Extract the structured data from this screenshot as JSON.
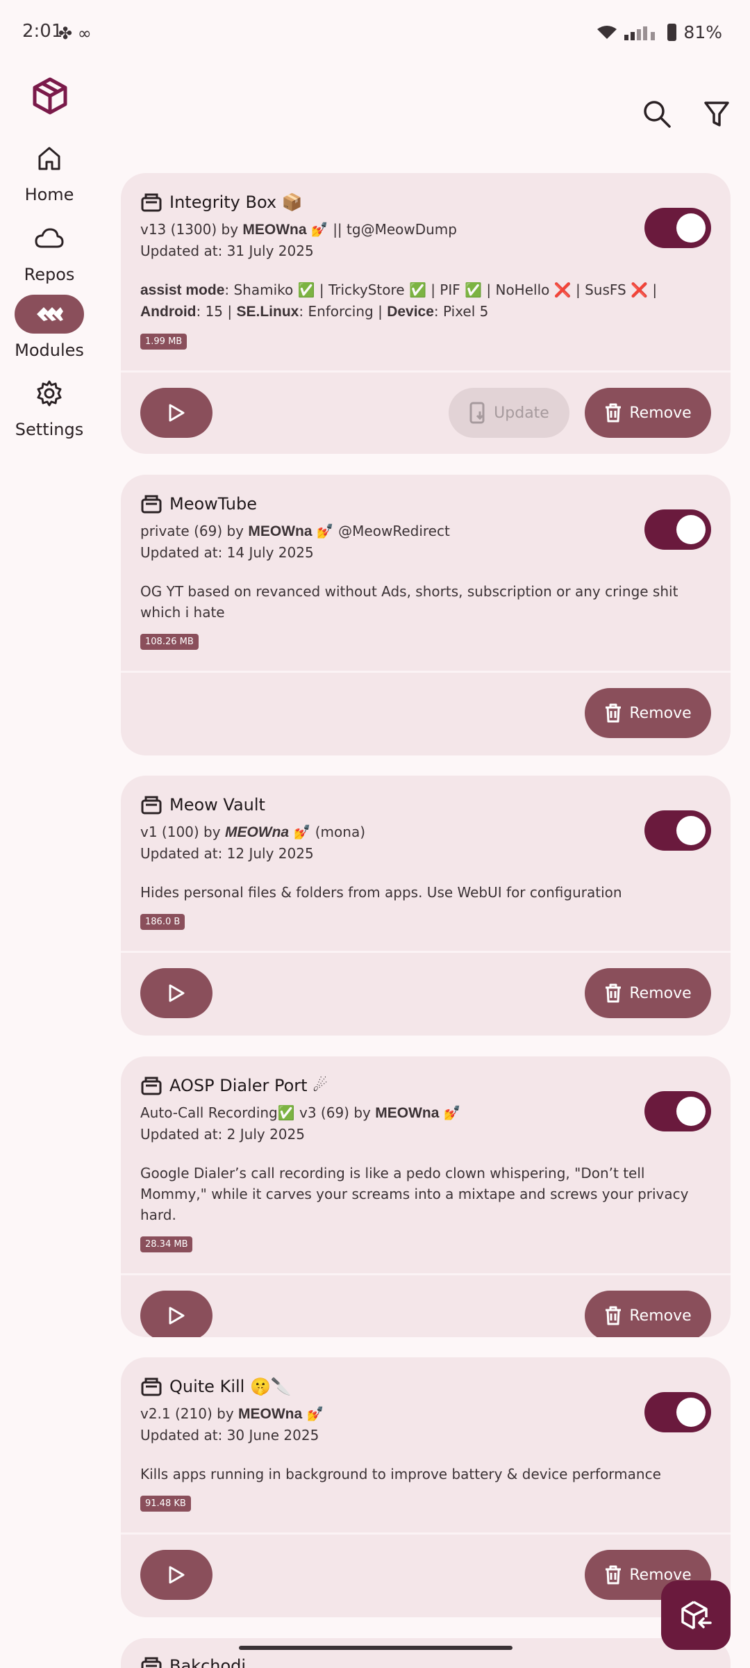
{
  "status": {
    "time": "2:01",
    "battery": "81%"
  },
  "nav": {
    "items": [
      {
        "label": "Home"
      },
      {
        "label": "Repos"
      },
      {
        "label": "Modules"
      },
      {
        "label": "Settings"
      }
    ]
  },
  "modules": [
    {
      "title": "Integrity Box 📦",
      "meta_line": [
        "v13 (1300) by ",
        "MEOWna",
        " 💅 || tg@MeowDump"
      ],
      "updated": "Updated at: 31 July 2025",
      "desc_rich": [
        {
          "b": "assist mode"
        },
        {
          "t": ": Shamiko ✅ | TrickyStore ✅ | PIF ✅ | NoHello ❌ | SusFS ❌ | "
        },
        {
          "b": "Android"
        },
        {
          "t": ": 15 | "
        },
        {
          "b": "SE.Linux"
        },
        {
          "t": ": Enforcing | "
        },
        {
          "b": "Device"
        },
        {
          "t": ": Pixel 5"
        }
      ],
      "size": "1.99 MB",
      "enabled": true,
      "has_play": true,
      "update_label": "Update",
      "remove_label": "Remove"
    },
    {
      "title": "MeowTube",
      "meta_line": [
        "private (69) by ",
        "MEOWna",
        " 💅  @MeowRedirect"
      ],
      "updated": "Updated at: 14 July 2025",
      "desc": "OG YT based on revanced without Ads, shorts, subscription or any cringe shit which i hate",
      "size": "108.26 MB",
      "enabled": true,
      "has_play": false,
      "remove_label": "Remove"
    },
    {
      "title": "Meow Vault",
      "meta_line": [
        "v1 (100) by ",
        "MEOWna",
        " 💅 (mona)"
      ],
      "meta_italic": true,
      "updated": "Updated at: 12 July 2025",
      "desc": "Hides personal files & folders from apps. Use WebUI for configuration",
      "size": "186.0 B",
      "enabled": true,
      "has_play": true,
      "remove_label": "Remove"
    },
    {
      "title": "AOSP Dialer Port ☄",
      "meta_line": [
        "Auto-Call Recording✅  v3 (69) by ",
        "MEOWna",
        " 💅"
      ],
      "updated": "Updated at: 2 July 2025",
      "desc": "Google Dialer’s call recording is like a pedo clown whispering, \"Don’t tell Mommy,\" while it carves your screams into a mixtape and screws your privacy hard.",
      "size": "28.34 MB",
      "enabled": true,
      "has_play": true,
      "remove_label": "Remove"
    },
    {
      "title": "Quite Kill 🤫🔪",
      "meta_line": [
        "v2.1 (210) by ",
        "MEOWna",
        " 💅"
      ],
      "updated": "Updated at: 30 June 2025",
      "desc": "Kills apps running in background to improve battery & device performance",
      "size": "91.48 KB",
      "enabled": true,
      "has_play": true,
      "remove_label": "Remove"
    },
    {
      "title": "Bakchodi"
    }
  ]
}
